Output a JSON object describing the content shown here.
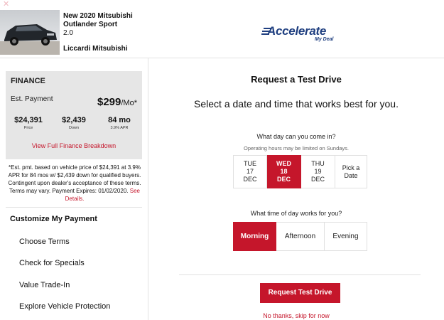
{
  "vehicle": {
    "title": "New 2020 Mitsubishi Outlander Sport",
    "trim": "2.0",
    "dealer": "Liccardi Mitsubishi"
  },
  "brand": {
    "name": "Accelerate",
    "tagline": "My Deal",
    "color": "#1f3f80"
  },
  "finance": {
    "heading": "FINANCE",
    "payment_label": "Est. Payment",
    "payment_value": "$299",
    "payment_unit": "/Mo*",
    "stats": [
      {
        "value": "$24,391",
        "label": "Price"
      },
      {
        "value": "$2,439",
        "label": "Down"
      },
      {
        "value": "84 mo",
        "label": "3.9% APR"
      }
    ],
    "breakdown_link": "View Full Finance Breakdown",
    "disclaimer": "*Est. pmt. based on vehicle price of $24,391 at 3.9% APR for 84 mos w/ $2,439 down for qualified buyers. Contingent upon dealer's acceptance of these terms. Terms may vary. Payment Expires: 01/02/2020.",
    "see_details": "See Details."
  },
  "customize": {
    "heading": "Customize My Payment",
    "items": [
      "Choose Terms",
      "Check for Specials",
      "Value Trade-In",
      "Explore Vehicle Protection"
    ]
  },
  "test_drive": {
    "title": "Request a Test Drive",
    "subtitle": "Select a date and time that works best for you.",
    "day_question": "What day can you come in?",
    "day_note": "Operating hours may be limited on Sundays.",
    "days": [
      {
        "dow": "TUE",
        "day": "17",
        "month": "DEC",
        "selected": false
      },
      {
        "dow": "WED",
        "day": "18",
        "month": "DEC",
        "selected": true
      },
      {
        "dow": "THU",
        "day": "19",
        "month": "DEC",
        "selected": false
      }
    ],
    "pick_date": "Pick a Date",
    "time_question": "What time of day works for you?",
    "times": [
      {
        "label": "Morning",
        "selected": true
      },
      {
        "label": "Afternoon",
        "selected": false
      },
      {
        "label": "Evening",
        "selected": false
      }
    ],
    "submit_label": "Request Test Drive",
    "skip_label": "No thanks, skip for now"
  },
  "colors": {
    "accent": "#c5162b",
    "panel": "#e6e6e6"
  },
  "icons": {
    "close": "close-icon",
    "brand_mark": "speed-lines-icon"
  }
}
